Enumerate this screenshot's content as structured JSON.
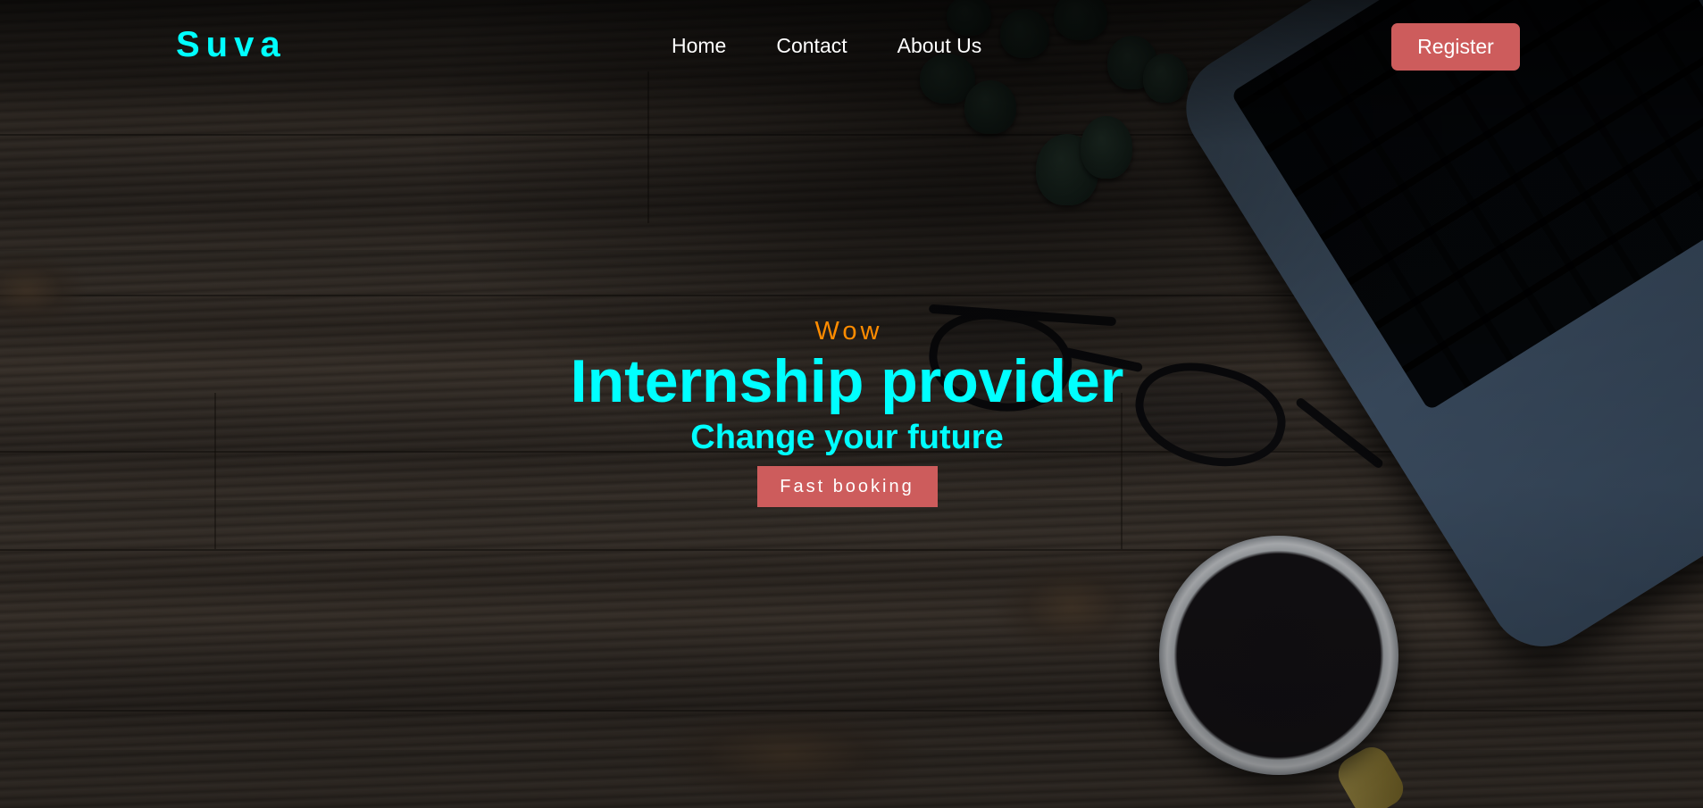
{
  "brand": {
    "logo_text": "Suva"
  },
  "nav": {
    "items": [
      {
        "label": "Home"
      },
      {
        "label": "Contact"
      },
      {
        "label": "About Us"
      }
    ],
    "register_label": "Register"
  },
  "hero": {
    "kicker": "Wow",
    "title": "Internship provider",
    "subtitle": "Change your future",
    "cta_label": "Fast booking"
  },
  "colors": {
    "brand_accent": "#00ffff",
    "kicker": "#ff8c00",
    "button": "#cd5c5c",
    "nav_text": "#ffffff"
  }
}
